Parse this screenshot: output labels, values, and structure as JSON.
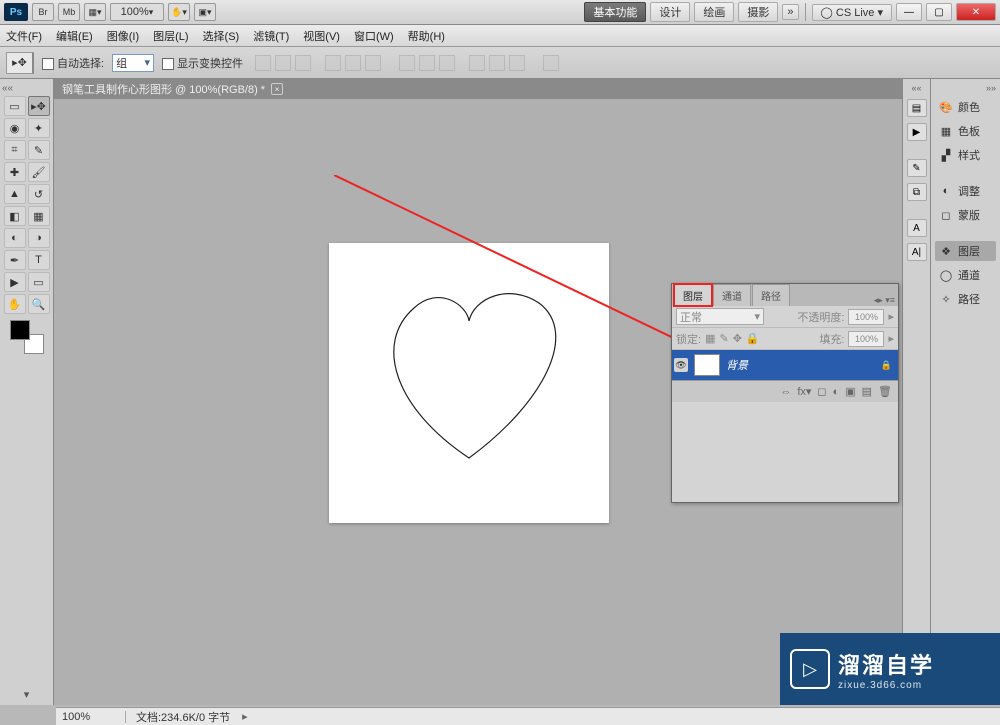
{
  "titlebar": {
    "logo": "Ps",
    "icons": [
      "Br",
      "Mb"
    ],
    "zoom": "100%",
    "workspace_basic": "基本功能",
    "workspace_items": [
      "设计",
      "绘画",
      "摄影"
    ],
    "more": "»",
    "cslive": "CS Live"
  },
  "menubar": [
    "文件(F)",
    "编辑(E)",
    "图像(I)",
    "图层(L)",
    "选择(S)",
    "滤镜(T)",
    "视图(V)",
    "窗口(W)",
    "帮助(H)"
  ],
  "optbar": {
    "auto_select": "自动选择:",
    "group": "组",
    "show_transform": "显示变换控件"
  },
  "document": {
    "tab": "钢笔工具制作心形图形 @ 100%(RGB/8) *"
  },
  "panels_right": {
    "group1": [
      "颜色",
      "色板",
      "样式"
    ],
    "group2": [
      "调整",
      "蒙版"
    ],
    "group3": [
      "图层",
      "通道",
      "路径"
    ]
  },
  "layers_panel": {
    "tabs": [
      "图层",
      "通道",
      "路径"
    ],
    "blend_mode": "正常",
    "opacity_label": "不透明度:",
    "opacity_value": "100%",
    "lock_label": "锁定:",
    "fill_label": "填充:",
    "fill_value": "100%",
    "layer_name": "背景"
  },
  "statusbar": {
    "zoom": "100%",
    "doc": "文档:234.6K/0 字节"
  },
  "watermark": {
    "brand": "溜溜自学",
    "url": "zixue.3d66.com"
  }
}
